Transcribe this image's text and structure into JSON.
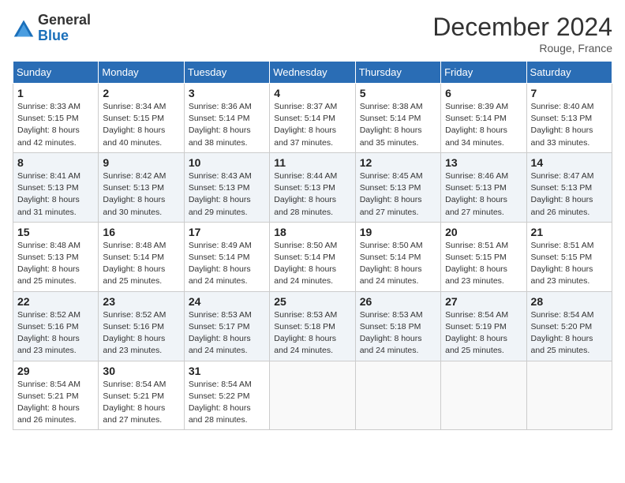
{
  "logo": {
    "general": "General",
    "blue": "Blue"
  },
  "header": {
    "month": "December 2024",
    "location": "Rouge, France"
  },
  "weekdays": [
    "Sunday",
    "Monday",
    "Tuesday",
    "Wednesday",
    "Thursday",
    "Friday",
    "Saturday"
  ],
  "weeks": [
    [
      {
        "day": "1",
        "sunrise": "8:33 AM",
        "sunset": "5:15 PM",
        "daylight": "8 hours and 42 minutes."
      },
      {
        "day": "2",
        "sunrise": "8:34 AM",
        "sunset": "5:15 PM",
        "daylight": "8 hours and 40 minutes."
      },
      {
        "day": "3",
        "sunrise": "8:36 AM",
        "sunset": "5:14 PM",
        "daylight": "8 hours and 38 minutes."
      },
      {
        "day": "4",
        "sunrise": "8:37 AM",
        "sunset": "5:14 PM",
        "daylight": "8 hours and 37 minutes."
      },
      {
        "day": "5",
        "sunrise": "8:38 AM",
        "sunset": "5:14 PM",
        "daylight": "8 hours and 35 minutes."
      },
      {
        "day": "6",
        "sunrise": "8:39 AM",
        "sunset": "5:14 PM",
        "daylight": "8 hours and 34 minutes."
      },
      {
        "day": "7",
        "sunrise": "8:40 AM",
        "sunset": "5:13 PM",
        "daylight": "8 hours and 33 minutes."
      }
    ],
    [
      {
        "day": "8",
        "sunrise": "8:41 AM",
        "sunset": "5:13 PM",
        "daylight": "8 hours and 31 minutes."
      },
      {
        "day": "9",
        "sunrise": "8:42 AM",
        "sunset": "5:13 PM",
        "daylight": "8 hours and 30 minutes."
      },
      {
        "day": "10",
        "sunrise": "8:43 AM",
        "sunset": "5:13 PM",
        "daylight": "8 hours and 29 minutes."
      },
      {
        "day": "11",
        "sunrise": "8:44 AM",
        "sunset": "5:13 PM",
        "daylight": "8 hours and 28 minutes."
      },
      {
        "day": "12",
        "sunrise": "8:45 AM",
        "sunset": "5:13 PM",
        "daylight": "8 hours and 27 minutes."
      },
      {
        "day": "13",
        "sunrise": "8:46 AM",
        "sunset": "5:13 PM",
        "daylight": "8 hours and 27 minutes."
      },
      {
        "day": "14",
        "sunrise": "8:47 AM",
        "sunset": "5:13 PM",
        "daylight": "8 hours and 26 minutes."
      }
    ],
    [
      {
        "day": "15",
        "sunrise": "8:48 AM",
        "sunset": "5:13 PM",
        "daylight": "8 hours and 25 minutes."
      },
      {
        "day": "16",
        "sunrise": "8:48 AM",
        "sunset": "5:14 PM",
        "daylight": "8 hours and 25 minutes."
      },
      {
        "day": "17",
        "sunrise": "8:49 AM",
        "sunset": "5:14 PM",
        "daylight": "8 hours and 24 minutes."
      },
      {
        "day": "18",
        "sunrise": "8:50 AM",
        "sunset": "5:14 PM",
        "daylight": "8 hours and 24 minutes."
      },
      {
        "day": "19",
        "sunrise": "8:50 AM",
        "sunset": "5:14 PM",
        "daylight": "8 hours and 24 minutes."
      },
      {
        "day": "20",
        "sunrise": "8:51 AM",
        "sunset": "5:15 PM",
        "daylight": "8 hours and 23 minutes."
      },
      {
        "day": "21",
        "sunrise": "8:51 AM",
        "sunset": "5:15 PM",
        "daylight": "8 hours and 23 minutes."
      }
    ],
    [
      {
        "day": "22",
        "sunrise": "8:52 AM",
        "sunset": "5:16 PM",
        "daylight": "8 hours and 23 minutes."
      },
      {
        "day": "23",
        "sunrise": "8:52 AM",
        "sunset": "5:16 PM",
        "daylight": "8 hours and 23 minutes."
      },
      {
        "day": "24",
        "sunrise": "8:53 AM",
        "sunset": "5:17 PM",
        "daylight": "8 hours and 24 minutes."
      },
      {
        "day": "25",
        "sunrise": "8:53 AM",
        "sunset": "5:18 PM",
        "daylight": "8 hours and 24 minutes."
      },
      {
        "day": "26",
        "sunrise": "8:53 AM",
        "sunset": "5:18 PM",
        "daylight": "8 hours and 24 minutes."
      },
      {
        "day": "27",
        "sunrise": "8:54 AM",
        "sunset": "5:19 PM",
        "daylight": "8 hours and 25 minutes."
      },
      {
        "day": "28",
        "sunrise": "8:54 AM",
        "sunset": "5:20 PM",
        "daylight": "8 hours and 25 minutes."
      }
    ],
    [
      {
        "day": "29",
        "sunrise": "8:54 AM",
        "sunset": "5:21 PM",
        "daylight": "8 hours and 26 minutes."
      },
      {
        "day": "30",
        "sunrise": "8:54 AM",
        "sunset": "5:21 PM",
        "daylight": "8 hours and 27 minutes."
      },
      {
        "day": "31",
        "sunrise": "8:54 AM",
        "sunset": "5:22 PM",
        "daylight": "8 hours and 28 minutes."
      },
      null,
      null,
      null,
      null
    ]
  ]
}
